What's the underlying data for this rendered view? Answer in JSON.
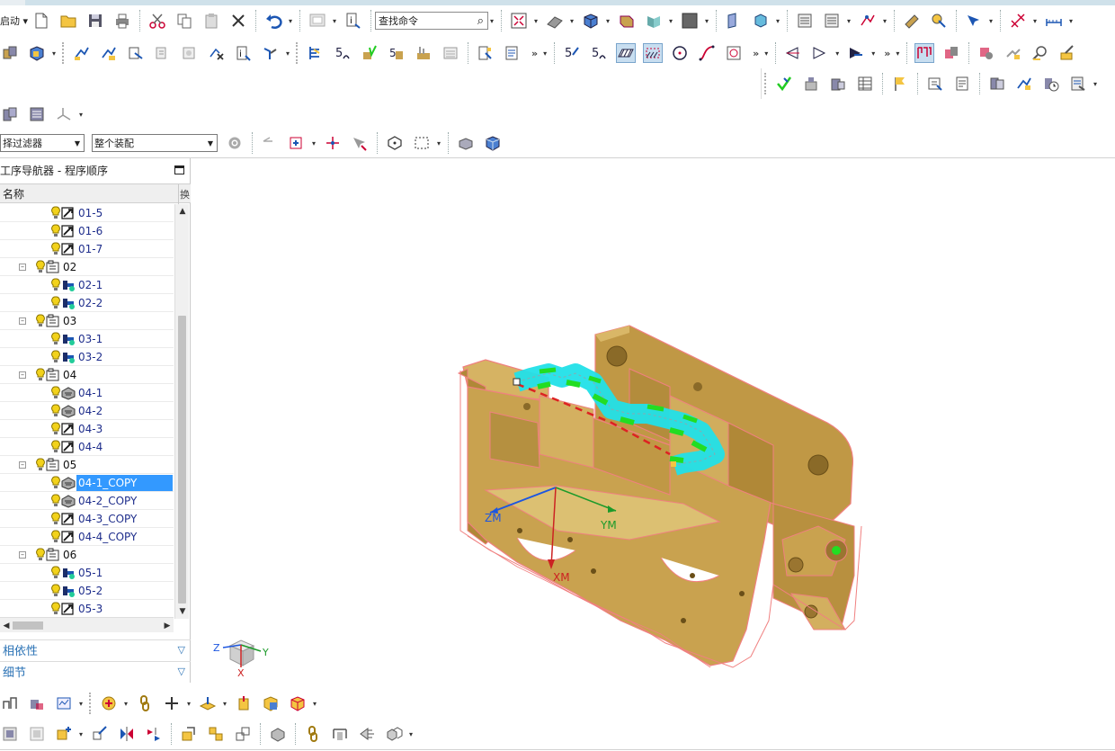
{
  "toolbar": {
    "start_label": "启动",
    "search_placeholder": "查找命令"
  },
  "filter": {
    "selection_filter": "择过滤器",
    "assembly_scope": "整个装配"
  },
  "navigator": {
    "title": "工序导航器 - 程序顺序",
    "column_name": "名称",
    "column_right": "换"
  },
  "tree": [
    {
      "label": "01-5",
      "kind": "op",
      "icon": "contour-op-icon",
      "indent": 2
    },
    {
      "label": "01-6",
      "kind": "op",
      "icon": "contour-op-icon",
      "indent": 2
    },
    {
      "label": "01-7",
      "kind": "op",
      "icon": "contour-op-icon",
      "indent": 2
    },
    {
      "label": "02",
      "kind": "group",
      "icon": "program-group-icon",
      "indent": 1
    },
    {
      "label": "02-1",
      "kind": "op",
      "icon": "drill-op-icon",
      "indent": 2
    },
    {
      "label": "02-2",
      "kind": "op",
      "icon": "drill-op-icon",
      "indent": 2
    },
    {
      "label": "03",
      "kind": "group",
      "icon": "program-group-icon",
      "indent": 1
    },
    {
      "label": "03-1",
      "kind": "op",
      "icon": "drill-op-icon",
      "indent": 2
    },
    {
      "label": "03-2",
      "kind": "op",
      "icon": "drill-op-icon",
      "indent": 2
    },
    {
      "label": "04",
      "kind": "group",
      "icon": "program-group-icon",
      "indent": 1
    },
    {
      "label": "04-1",
      "kind": "op",
      "icon": "cavity-mill-icon",
      "indent": 2
    },
    {
      "label": "04-2",
      "kind": "op",
      "icon": "cavity-mill-icon",
      "indent": 2
    },
    {
      "label": "04-3",
      "kind": "op",
      "icon": "contour-op-icon",
      "indent": 2
    },
    {
      "label": "04-4",
      "kind": "op",
      "icon": "contour-op-icon",
      "indent": 2
    },
    {
      "label": "05",
      "kind": "group",
      "icon": "program-group-icon",
      "indent": 1
    },
    {
      "label": "04-1_COPY",
      "kind": "op",
      "icon": "cavity-mill-icon",
      "indent": 2,
      "selected": true
    },
    {
      "label": "04-2_COPY",
      "kind": "op",
      "icon": "cavity-mill-icon",
      "indent": 2
    },
    {
      "label": "04-3_COPY",
      "kind": "op",
      "icon": "contour-op-icon",
      "indent": 2
    },
    {
      "label": "04-4_COPY",
      "kind": "op",
      "icon": "contour-op-icon",
      "indent": 2
    },
    {
      "label": "06",
      "kind": "group",
      "icon": "program-group-icon",
      "indent": 1
    },
    {
      "label": "05-1",
      "kind": "op",
      "icon": "drill-op-icon",
      "indent": 2
    },
    {
      "label": "05-2",
      "kind": "op",
      "icon": "drill-op-icon",
      "indent": 2
    },
    {
      "label": "05-3",
      "kind": "op",
      "icon": "contour-op-icon",
      "indent": 2
    }
  ],
  "sections": {
    "dependencies": "相依性",
    "details": "细节"
  },
  "viewport": {
    "axis_zm": "ZM",
    "axis_ym": "YM",
    "axis_xm": "XM",
    "triad_z": "Z",
    "triad_y": "Y",
    "triad_x": "X"
  },
  "colors": {
    "part_body": "#c9a24f",
    "part_edge": "#f08080",
    "toolpath_cyan": "#22e0e8",
    "toolpath_green": "#22dd22",
    "selection_blue": "#3399ff",
    "section_text": "#2a72b5"
  }
}
